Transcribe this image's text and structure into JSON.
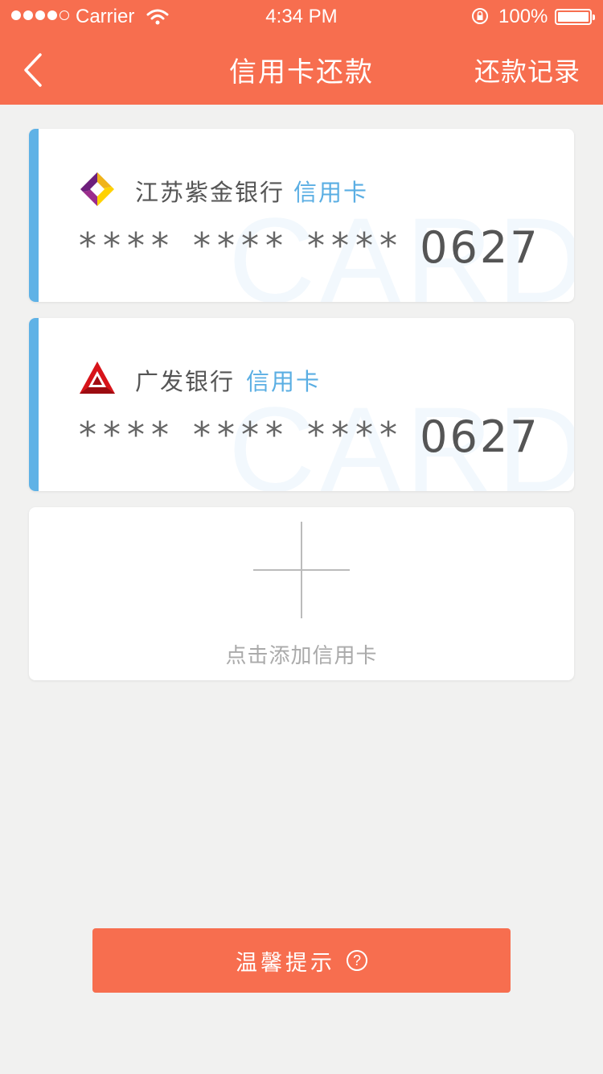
{
  "status_bar": {
    "carrier": "Carrier",
    "time": "4:34 PM",
    "battery": "100%"
  },
  "nav": {
    "back_icon": "chevron-left-icon",
    "title": "信用卡还款",
    "right_action": "还款记录"
  },
  "cards": [
    {
      "bank_name": "江苏紫金银行",
      "card_type": "信用卡",
      "masked": "**** **** ****",
      "last4": "0627",
      "watermark": "CARD",
      "logo_icon": "zijin-bank-logo-icon"
    },
    {
      "bank_name": "广发银行",
      "card_type": "信用卡",
      "masked": "**** **** ****",
      "last4": "0627",
      "watermark": "CARD",
      "logo_icon": "cgb-bank-logo-icon"
    }
  ],
  "add_card": {
    "label": "点击添加信用卡",
    "icon": "plus-icon"
  },
  "tips": {
    "label": "温馨提示",
    "icon": "question-circle-icon",
    "icon_glyph": "?"
  },
  "colors": {
    "brand": "#f76e4f",
    "accent_blue": "#5fb2e6",
    "background": "#f1f1f0"
  }
}
